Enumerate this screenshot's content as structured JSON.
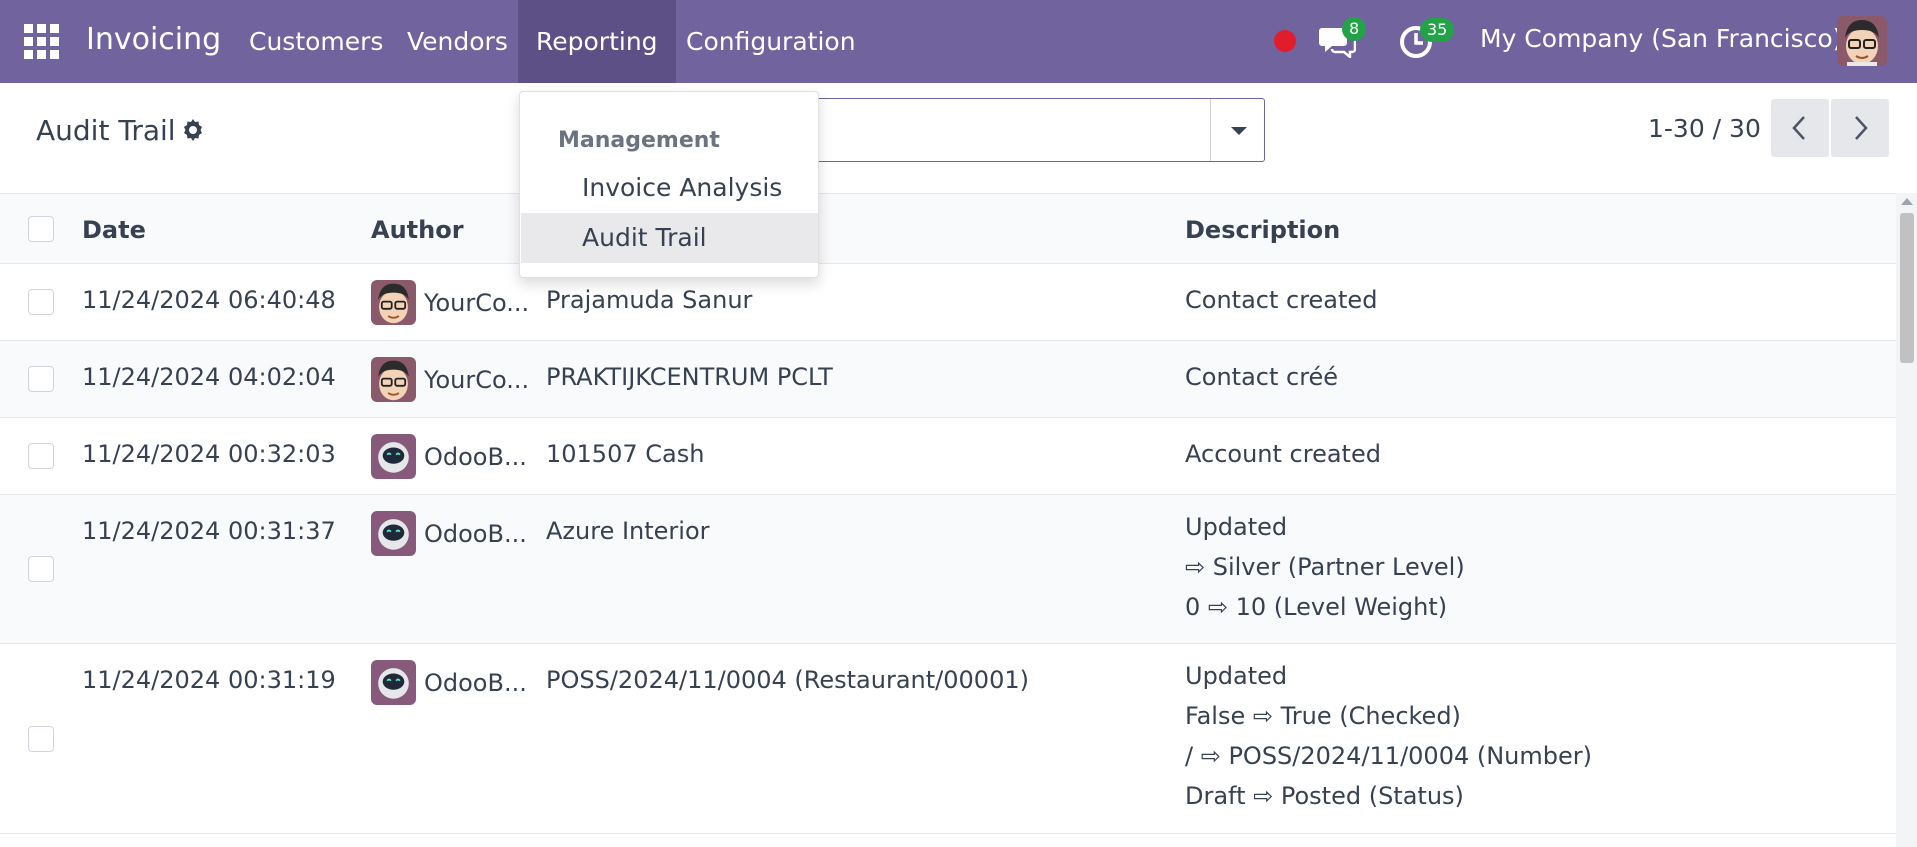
{
  "navbar": {
    "app_name": "Invoicing",
    "menus": [
      "Customers",
      "Vendors",
      "Reporting",
      "Configuration"
    ],
    "active_menu": "Reporting",
    "chat_badge": "8",
    "activity_badge": "35",
    "company": "My Company (San Francisco)",
    "color": "#71639e"
  },
  "control_panel": {
    "title": "Audit Trail",
    "search_placeholder": "",
    "pager": "1-30 / 30"
  },
  "dropdown": {
    "section_header": "Management",
    "items": [
      "Invoice Analysis",
      "Audit Trail"
    ],
    "selected": "Audit Trail"
  },
  "table": {
    "columns": [
      "Date",
      "Author",
      "",
      "Description"
    ],
    "rows": [
      {
        "date": "11/24/2024 06:40:48",
        "author": "YourCo...",
        "avatar": "user-avatar",
        "record": "Prajamuda Sanur",
        "description": [
          "Contact created"
        ]
      },
      {
        "date": "11/24/2024 04:02:04",
        "author": "YourCo...",
        "avatar": "user-avatar",
        "record": "PRAKTIJKCENTRUM PCLT",
        "description": [
          "Contact créé"
        ]
      },
      {
        "date": "11/24/2024 00:32:03",
        "author": "OdooB...",
        "avatar": "bot-avatar",
        "record": "101507 Cash",
        "description": [
          "Account created"
        ]
      },
      {
        "date": "11/24/2024 00:31:37",
        "author": "OdooB...",
        "avatar": "bot-avatar",
        "record": "Azure Interior",
        "description": [
          "Updated",
          " ⇨ Silver (Partner Level)",
          "0 ⇨ 10 (Level Weight)"
        ]
      },
      {
        "date": "11/24/2024 00:31:19",
        "author": "OdooB...",
        "avatar": "bot-avatar",
        "record": "POSS/2024/11/0004 (Restaurant/00001)",
        "description": [
          "Updated",
          "False ⇨ True (Checked)",
          "/ ⇨ POSS/2024/11/0004 (Number)",
          "Draft ⇨ Posted (Status)"
        ]
      }
    ]
  }
}
